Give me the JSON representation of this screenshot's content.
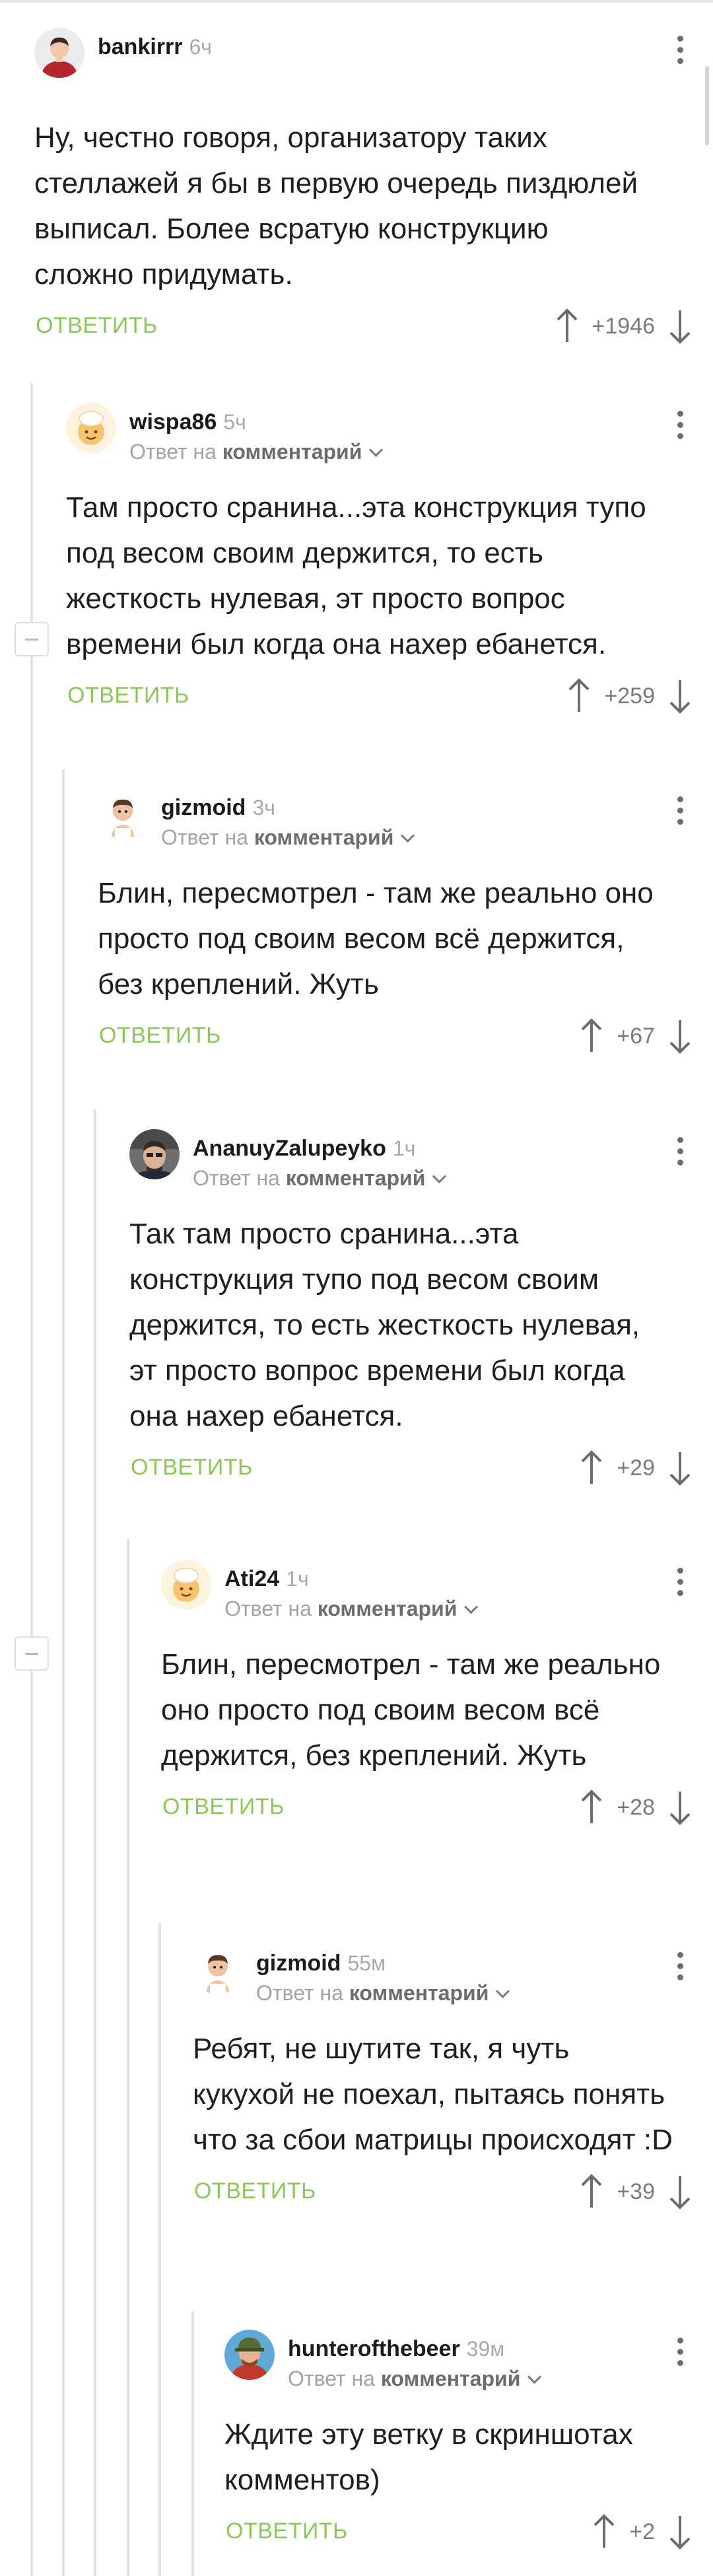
{
  "comments": [
    {
      "author": "bankirrr",
      "time": "6ч",
      "reply_prefix": "",
      "reply_target": "",
      "text": "Ну, честно говоря, организатору таких стеллажей я бы в первую очередь пиздюлей выписал. Более всратую конструкцию сложно придумать.",
      "reply_label": "ОТВЕТИТЬ",
      "rating": "+1946",
      "avatar": "man-red-shirt"
    },
    {
      "author": "wispa86",
      "time": "5ч",
      "reply_prefix": "Ответ на",
      "reply_target": "комментарий",
      "text": "Там просто сранина...эта конструкция тупо под весом своим держится, то есть жесткость нулевая, эт просто вопрос времени был когда она нахер ебанется.",
      "reply_label": "ОТВЕТИТЬ",
      "rating": "+259",
      "avatar": "chef-default"
    },
    {
      "author": "gizmoid",
      "time": "3ч",
      "reply_prefix": "Ответ на",
      "reply_target": "комментарий",
      "text": "Блин, пересмотрел - там же реально оно просто под своим весом всё держится, без креплений. Жуть",
      "reply_label": "ОТВЕТИТЬ",
      "rating": "+67",
      "avatar": "cartoon-man"
    },
    {
      "author": "AnanuyZalupeyko",
      "time": "1ч",
      "reply_prefix": "Ответ на",
      "reply_target": "комментарий",
      "text": "Так там просто сранина...эта конструкция тупо под весом своим держится, то есть жесткость нулевая, эт просто вопрос времени был когда она нахер ебанется.",
      "reply_label": "ОТВЕТИТЬ",
      "rating": "+29",
      "avatar": "photo-man"
    },
    {
      "author": "Ati24",
      "time": "1ч",
      "reply_prefix": "Ответ на",
      "reply_target": "комментарий",
      "text": "Блин, пересмотрел - там же реально оно просто под своим весом всё держится, без креплений. Жуть",
      "reply_label": "ОТВЕТИТЬ",
      "rating": "+28",
      "avatar": "chef-default"
    },
    {
      "author": "gizmoid",
      "time": "55м",
      "reply_prefix": "Ответ на",
      "reply_target": "комментарий",
      "text": "Ребят, не шутите так, я чуть кукухой не поехал, пытаясь понять что за сбои матрицы происходят :D",
      "reply_label": "ОТВЕТИТЬ",
      "rating": "+39",
      "avatar": "cartoon-man"
    },
    {
      "author": "hunterofthebeer",
      "time": "39м",
      "reply_prefix": "Ответ на",
      "reply_target": "комментарий",
      "text": "Ждите эту ветку в скриншотах комментов)",
      "reply_label": "ОТВЕТИТЬ",
      "rating": "+2",
      "avatar": "hunter"
    }
  ],
  "colors": {
    "accent_green": "#8ac858",
    "thread_line": "#e2e2e2",
    "muted_text": "#a3a3a3"
  }
}
